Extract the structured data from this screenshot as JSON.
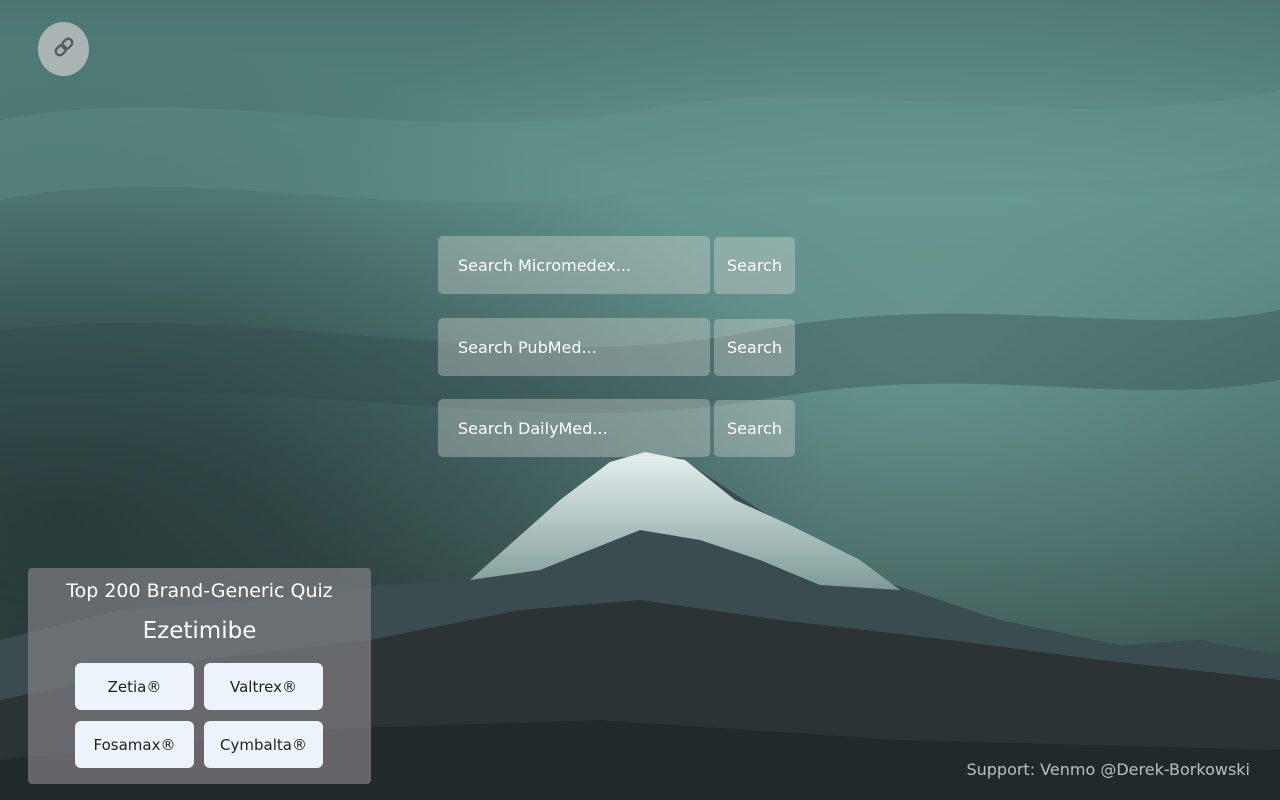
{
  "link_button": {
    "icon": "link-icon"
  },
  "searches": [
    {
      "placeholder": "Search Micromedex...",
      "button": "Search"
    },
    {
      "placeholder": "Search PubMed...",
      "button": "Search"
    },
    {
      "placeholder": "Search DailyMed...",
      "button": "Search"
    }
  ],
  "quiz": {
    "title": "Top 200 Brand-Generic Quiz",
    "drug": "Ezetimibe",
    "answers": [
      "Zetia®",
      "Valtrex®",
      "Fosamax®",
      "Cymbalta®"
    ]
  },
  "footer": {
    "support": "Support: Venmo @Derek-Borkowski"
  },
  "background": {
    "description_icon": "mountain-background"
  }
}
